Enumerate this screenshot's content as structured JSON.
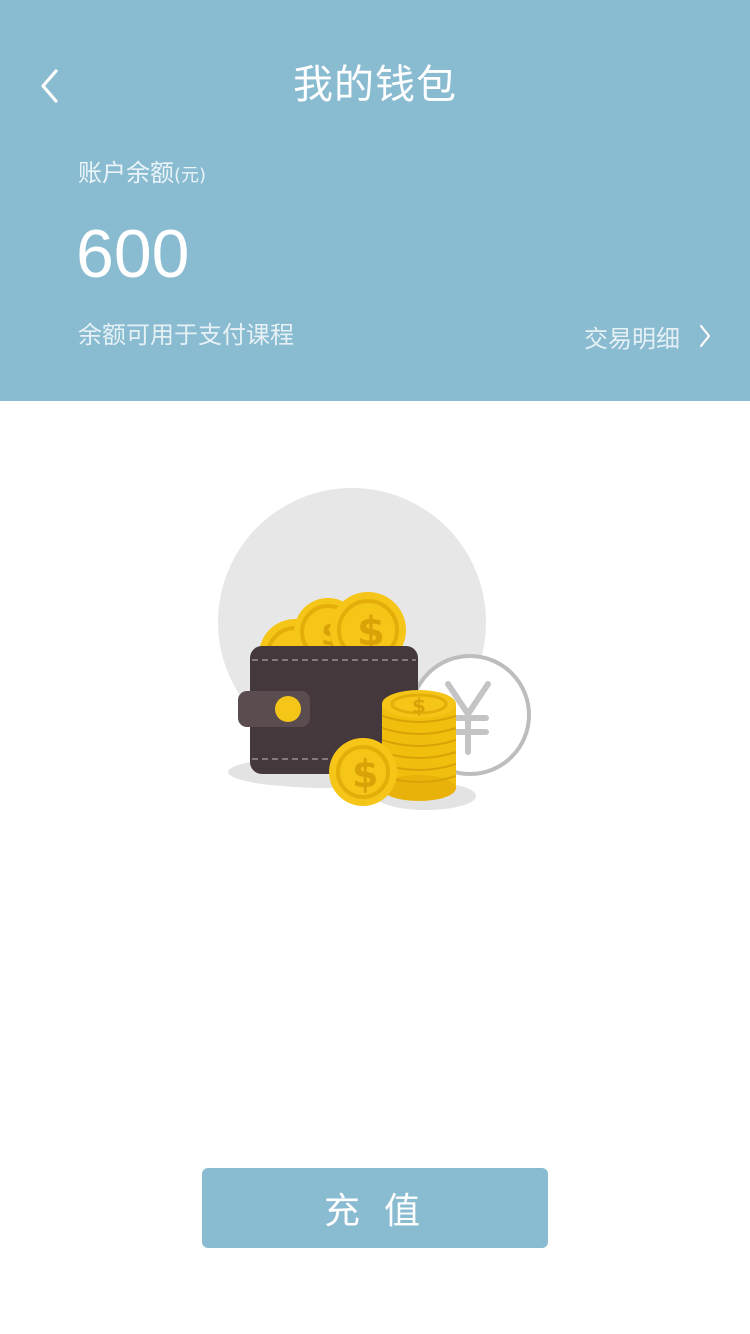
{
  "header": {
    "title": "我的钱包",
    "back_icon": "chevron-left-icon"
  },
  "balance": {
    "label": "账户余额",
    "unit": "(元)",
    "amount": "600",
    "hint": "余额可用于支付课程"
  },
  "transactions": {
    "label": "交易明细",
    "icon": "chevron-right-icon"
  },
  "illustration": {
    "icon": "wallet-with-coins-illustration"
  },
  "actions": {
    "recharge_label": "充值"
  },
  "colors": {
    "accent": "#89bbd1",
    "coin": "#f5c518",
    "wallet": "#45383c"
  }
}
